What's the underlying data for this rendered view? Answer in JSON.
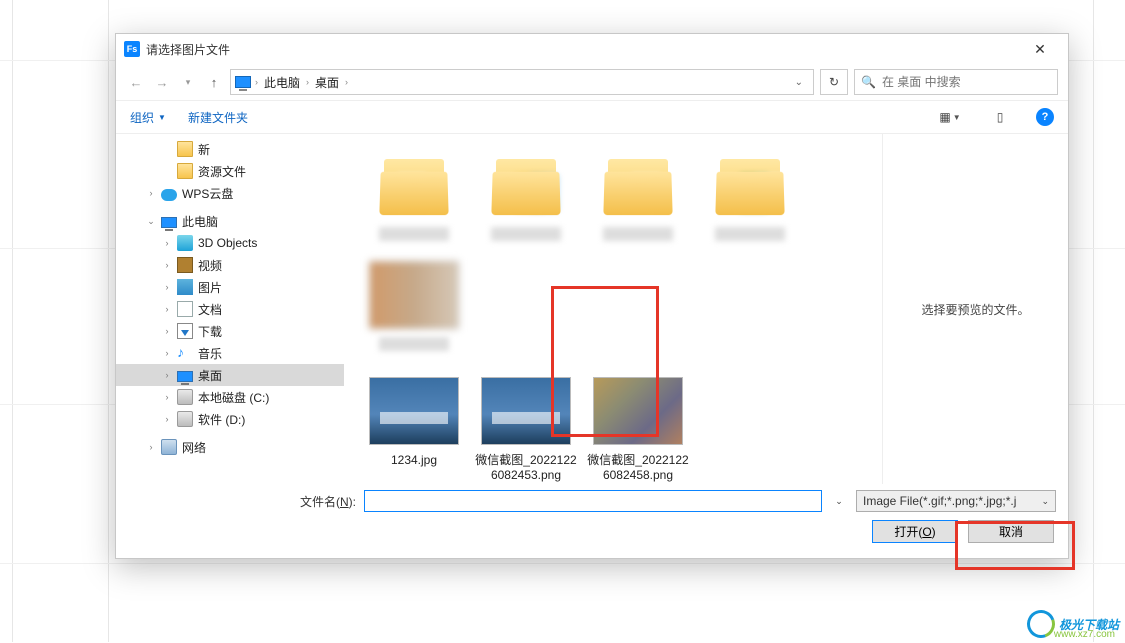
{
  "title": "请选择图片文件",
  "breadcrumb": {
    "root": "此电脑",
    "current": "桌面"
  },
  "search": {
    "placeholder": "在 桌面 中搜索"
  },
  "toolbar": {
    "organize": "组织",
    "newfolder": "新建文件夹"
  },
  "tree": {
    "xin": "新",
    "ziyuan": "资源文件",
    "wps": "WPS云盘",
    "thispc": "此电脑",
    "threeD": "3D Objects",
    "video": "视频",
    "pictures": "图片",
    "documents": "文档",
    "downloads": "下载",
    "music": "音乐",
    "desktop": "桌面",
    "diskC": "本地磁盘 (C:)",
    "diskD": "软件 (D:)",
    "network": "网络"
  },
  "files": {
    "f1": "1234.jpg",
    "f2": "微信截图_20221226082453.png",
    "f3": "微信截图_20221226082458.png"
  },
  "preview": {
    "empty": "选择要预览的文件。"
  },
  "filerow": {
    "label_pre": "文件名(",
    "label_hot": "N",
    "label_post": "):",
    "value": "",
    "filter": "Image File(*.gif;*.png;*.jpg;*.j"
  },
  "buttons": {
    "open_pre": "打开(",
    "open_hot": "O",
    "open_post": ")",
    "cancel": "取消"
  },
  "watermark": {
    "brand": "极光下载站",
    "url": "www.xz7.com"
  }
}
